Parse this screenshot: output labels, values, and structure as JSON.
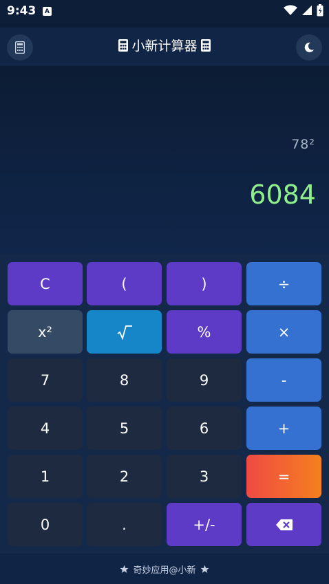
{
  "status": {
    "time": "9:43",
    "app_icon_letter": "A"
  },
  "header": {
    "title": "小新计算器"
  },
  "display": {
    "expression": "78²",
    "result": "6084"
  },
  "keys": {
    "clear": "C",
    "lparen": "(",
    "rparen": ")",
    "divide": "÷",
    "square": "x²",
    "percent": "%",
    "multiply": "×",
    "seven": "7",
    "eight": "8",
    "nine": "9",
    "minus": "-",
    "four": "4",
    "five": "5",
    "six": "6",
    "plus": "+",
    "one": "1",
    "two": "2",
    "three": "3",
    "equals": "=",
    "zero": "0",
    "dot": ".",
    "negate": "+/-"
  },
  "footer": {
    "text": "奇妙应用@小新"
  },
  "colors": {
    "background": "#0b1d36",
    "result": "#90f08c",
    "purple": "#5d3bc7",
    "blue": "#3471d0",
    "equals_start": "#ef4a44",
    "equals_end": "#f5801e"
  }
}
